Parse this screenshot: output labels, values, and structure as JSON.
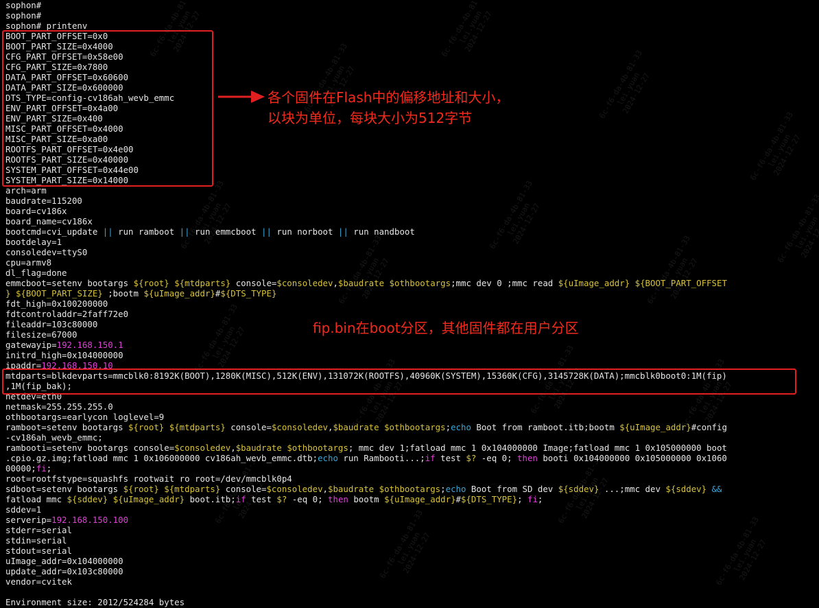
{
  "terminal": {
    "prompt": "sophon#",
    "lines": [
      [
        {
          "t": "sophon#"
        }
      ],
      [
        {
          "t": "sophon#"
        }
      ],
      [
        {
          "t": "sophon# printenv"
        }
      ],
      [
        {
          "t": "BOOT_PART_OFFSET=0x0"
        }
      ],
      [
        {
          "t": "BOOT_PART_SIZE=0x4000"
        }
      ],
      [
        {
          "t": "CFG_PART_OFFSET=0x58e00"
        }
      ],
      [
        {
          "t": "CFG_PART_SIZE=0x7800"
        }
      ],
      [
        {
          "t": "DATA_PART_OFFSET=0x60600"
        }
      ],
      [
        {
          "t": "DATA_PART_SIZE=0x600000"
        }
      ],
      [
        {
          "t": "DTS_TYPE=config-cv186ah_wevb_emmc"
        }
      ],
      [
        {
          "t": "ENV_PART_OFFSET=0x4a00"
        }
      ],
      [
        {
          "t": "ENV_PART_SIZE=0x400"
        }
      ],
      [
        {
          "t": "MISC_PART_OFFSET=0x4000"
        }
      ],
      [
        {
          "t": "MISC_PART_SIZE=0xa00"
        }
      ],
      [
        {
          "t": "ROOTFS_PART_OFFSET=0x4e00"
        }
      ],
      [
        {
          "t": "ROOTFS_PART_SIZE=0x40000"
        }
      ],
      [
        {
          "t": "SYSTEM_PART_OFFSET=0x44e00"
        }
      ],
      [
        {
          "t": "SYSTEM_PART_SIZE=0x14000"
        }
      ],
      [
        {
          "t": "arch=arm"
        }
      ],
      [
        {
          "t": "baudrate=115200"
        }
      ],
      [
        {
          "t": "board=cv186x"
        }
      ],
      [
        {
          "t": "board_name=cv186x"
        }
      ],
      [
        {
          "t": "bootcmd=cvi_update "
        },
        {
          "t": "||",
          "c": "b"
        },
        {
          "t": " run ramboot "
        },
        {
          "t": "||",
          "c": "b"
        },
        {
          "t": " run emmcboot "
        },
        {
          "t": "||",
          "c": "b"
        },
        {
          "t": " run norboot "
        },
        {
          "t": "||",
          "c": "b"
        },
        {
          "t": " run nandboot"
        }
      ],
      [
        {
          "t": "bootdelay=1"
        }
      ],
      [
        {
          "t": "consoledev=ttyS0"
        }
      ],
      [
        {
          "t": "cpu=armv8"
        }
      ],
      [
        {
          "t": "dl_flag=done"
        }
      ],
      [
        {
          "t": "emmcboot=setenv bootargs "
        },
        {
          "t": "${root}",
          "c": "y"
        },
        {
          "t": " "
        },
        {
          "t": "${mtdparts}",
          "c": "y"
        },
        {
          "t": " console="
        },
        {
          "t": "$consoledev",
          "c": "y"
        },
        {
          "t": ","
        },
        {
          "t": "$baudrate",
          "c": "y"
        },
        {
          "t": " "
        },
        {
          "t": "$othbootargs",
          "c": "y"
        },
        {
          "t": ";mmc dev 0 ;mmc read "
        },
        {
          "t": "${uImage_addr}",
          "c": "y"
        },
        {
          "t": " "
        },
        {
          "t": "${BOOT_PART_OFFSET",
          "c": "y"
        }
      ],
      [
        {
          "t": "}",
          "c": "y"
        },
        {
          "t": " "
        },
        {
          "t": "${BOOT_PART_SIZE}",
          "c": "y"
        },
        {
          "t": " ;bootm "
        },
        {
          "t": "${uImage_addr}",
          "c": "y"
        },
        {
          "t": "#"
        },
        {
          "t": "${DTS_TYPE}",
          "c": "y"
        }
      ],
      [
        {
          "t": "fdt_high=0x100200000"
        }
      ],
      [
        {
          "t": "fdtcontroladdr=2faff72e0"
        }
      ],
      [
        {
          "t": "fileaddr=103c80000"
        }
      ],
      [
        {
          "t": "filesize=67000"
        }
      ],
      [
        {
          "t": "gatewayip="
        },
        {
          "t": "192.168.150.1",
          "c": "m"
        }
      ],
      [
        {
          "t": "initrd_high=0x104000000"
        }
      ],
      [
        {
          "t": "ipaddr="
        },
        {
          "t": "192.168.150.10",
          "c": "m"
        }
      ],
      [
        {
          "t": "mtdparts=blkdevparts=mmcblk0:8192K(BOOT),1280K(MISC),512K(ENV),131072K(ROOTFS),40960K(SYSTEM),15360K(CFG),3145728K(DATA);mmcblk0boot0:1M(fip)"
        }
      ],
      [
        {
          "t": ",1M(fip_bak);"
        }
      ],
      [
        {
          "t": "netdev=eth0"
        }
      ],
      [
        {
          "t": "netmask=255.255.255.0"
        }
      ],
      [
        {
          "t": "othbootargs=earlycon loglevel=9"
        }
      ],
      [
        {
          "t": "ramboot=setenv bootargs "
        },
        {
          "t": "${root}",
          "c": "y"
        },
        {
          "t": " "
        },
        {
          "t": "${mtdparts}",
          "c": "y"
        },
        {
          "t": " console="
        },
        {
          "t": "$consoledev",
          "c": "y"
        },
        {
          "t": ","
        },
        {
          "t": "$baudrate",
          "c": "y"
        },
        {
          "t": " "
        },
        {
          "t": "$othbootargs",
          "c": "y"
        },
        {
          "t": ";"
        },
        {
          "t": "echo",
          "c": "b"
        },
        {
          "t": " Boot from ramboot.itb;bootm "
        },
        {
          "t": "${uImage_addr}",
          "c": "y"
        },
        {
          "t": "#config"
        }
      ],
      [
        {
          "t": "-cv186ah_wevb_emmc;"
        }
      ],
      [
        {
          "t": "rambooti=setenv bootargs console="
        },
        {
          "t": "$consoledev",
          "c": "y"
        },
        {
          "t": ","
        },
        {
          "t": "$baudrate",
          "c": "y"
        },
        {
          "t": " "
        },
        {
          "t": "$othbootargs",
          "c": "y"
        },
        {
          "t": "; mmc dev 1;fatload mmc 1 0x104000000 Image;fatload mmc 1 0x105000000 boot"
        }
      ],
      [
        {
          "t": ".cpio.gz.img;fatload mmc 1 0x106000000 cv186ah_wevb_emmc.dtb;"
        },
        {
          "t": "echo",
          "c": "b"
        },
        {
          "t": " run Rambooti...;"
        },
        {
          "t": "if",
          "c": "m"
        },
        {
          "t": " test "
        },
        {
          "t": "$?",
          "c": "y"
        },
        {
          "t": " -eq 0; "
        },
        {
          "t": "then",
          "c": "m"
        },
        {
          "t": " booti 0x104000000 0x105000000 0x1060"
        }
      ],
      [
        {
          "t": "00000;"
        },
        {
          "t": "fi",
          "c": "m"
        },
        {
          "t": ";"
        }
      ],
      [
        {
          "t": "root=rootfstype=squashfs rootwait ro root=/dev/mmcblk0p4"
        }
      ],
      [
        {
          "t": "sdboot=setenv bootargs "
        },
        {
          "t": "${root}",
          "c": "y"
        },
        {
          "t": " "
        },
        {
          "t": "${mtdparts}",
          "c": "y"
        },
        {
          "t": " console="
        },
        {
          "t": "$consoledev",
          "c": "y"
        },
        {
          "t": ","
        },
        {
          "t": "$baudrate",
          "c": "y"
        },
        {
          "t": " "
        },
        {
          "t": "$othbootargs",
          "c": "y"
        },
        {
          "t": ";"
        },
        {
          "t": "echo",
          "c": "b"
        },
        {
          "t": " Boot from SD dev "
        },
        {
          "t": "${sddev}",
          "c": "y"
        },
        {
          "t": " ...;mmc dev "
        },
        {
          "t": "${sddev}",
          "c": "y"
        },
        {
          "t": " "
        },
        {
          "t": "&&",
          "c": "b"
        }
      ],
      [
        {
          "t": "fatload mmc "
        },
        {
          "t": "${sddev}",
          "c": "y"
        },
        {
          "t": " "
        },
        {
          "t": "${uImage_addr}",
          "c": "y"
        },
        {
          "t": " boot.itb;"
        },
        {
          "t": "if",
          "c": "m"
        },
        {
          "t": " test "
        },
        {
          "t": "$?",
          "c": "y"
        },
        {
          "t": " -eq 0; "
        },
        {
          "t": "then",
          "c": "m"
        },
        {
          "t": " bootm "
        },
        {
          "t": "${uImage_addr}",
          "c": "y"
        },
        {
          "t": "#"
        },
        {
          "t": "${DTS_TYPE}",
          "c": "y"
        },
        {
          "t": "; "
        },
        {
          "t": "fi",
          "c": "m"
        },
        {
          "t": ";"
        }
      ],
      [
        {
          "t": "sddev=1"
        }
      ],
      [
        {
          "t": "serverip="
        },
        {
          "t": "192.168.150.100",
          "c": "m"
        }
      ],
      [
        {
          "t": "stderr=serial"
        }
      ],
      [
        {
          "t": "stdin=serial"
        }
      ],
      [
        {
          "t": "stdout=serial"
        }
      ],
      [
        {
          "t": "uImage_addr=0x104000000"
        }
      ],
      [
        {
          "t": "update_addr=0x103c80000"
        }
      ],
      [
        {
          "t": "vendor=cvitek"
        }
      ],
      [],
      [
        {
          "t": "Environment size: 2012/524284 bytes"
        }
      ]
    ]
  },
  "annotations": {
    "partition_note_line1": "各个固件在Flash中的偏移地址和大小，",
    "partition_note_line2": "以块为单位，每块大小为512字节",
    "fip_note": "fip.bin在boot分区，其他固件都在用户分区"
  },
  "watermark": {
    "lines": [
      "6c-f6-da-4b-81-33",
      "lei.yuan",
      "2024-12-27"
    ]
  },
  "colors": {
    "background": "#000000",
    "text": "#e6e6e6",
    "variable": "#d8c23a",
    "keyword_blue": "#3aa6d8",
    "keyword_magenta": "#e040d8",
    "annotation": "#f22a1c"
  }
}
